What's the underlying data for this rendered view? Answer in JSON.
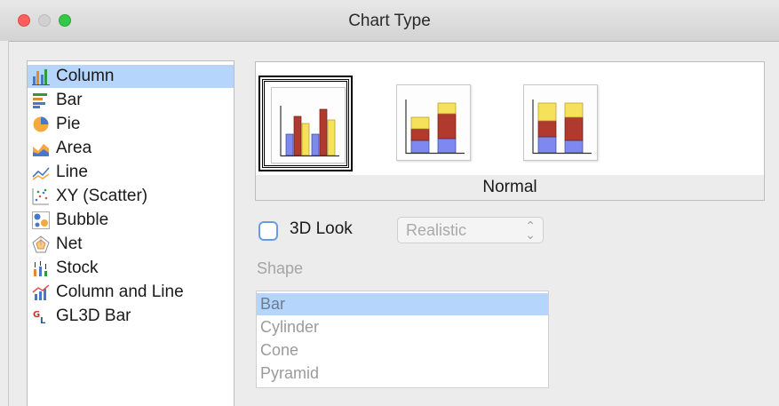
{
  "window": {
    "title": "Chart Type"
  },
  "chart_types": [
    {
      "label": "Column",
      "icon": "column-chart-icon",
      "selected": true
    },
    {
      "label": "Bar",
      "icon": "bar-chart-icon"
    },
    {
      "label": "Pie",
      "icon": "pie-chart-icon"
    },
    {
      "label": "Area",
      "icon": "area-chart-icon"
    },
    {
      "label": "Line",
      "icon": "line-chart-icon"
    },
    {
      "label": "XY (Scatter)",
      "icon": "scatter-chart-icon"
    },
    {
      "label": "Bubble",
      "icon": "bubble-chart-icon"
    },
    {
      "label": "Net",
      "icon": "net-chart-icon"
    },
    {
      "label": "Stock",
      "icon": "stock-chart-icon"
    },
    {
      "label": "Column and Line",
      "icon": "column-line-chart-icon"
    },
    {
      "label": "GL3D Bar",
      "icon": "gl3d-bar-icon"
    }
  ],
  "variants": {
    "items": [
      {
        "name": "Normal",
        "icon": "normal-column-icon",
        "selected": true
      },
      {
        "name": "stacked",
        "icon": "stacked-column-icon"
      },
      {
        "name": "percent-stacked",
        "icon": "percent-stacked-column-icon"
      }
    ],
    "caption": "Normal"
  },
  "three_d": {
    "label": "3D Look",
    "checked": false,
    "style_value": "Realistic"
  },
  "shape": {
    "label": "Shape",
    "options": [
      "Bar",
      "Cylinder",
      "Cone",
      "Pyramid"
    ],
    "selected": "Bar"
  },
  "colors": {
    "selection": "#b5d5fd",
    "bar_blue": "#7e89f0",
    "bar_red": "#b03a2e",
    "bar_yellow": "#f6e25a"
  }
}
